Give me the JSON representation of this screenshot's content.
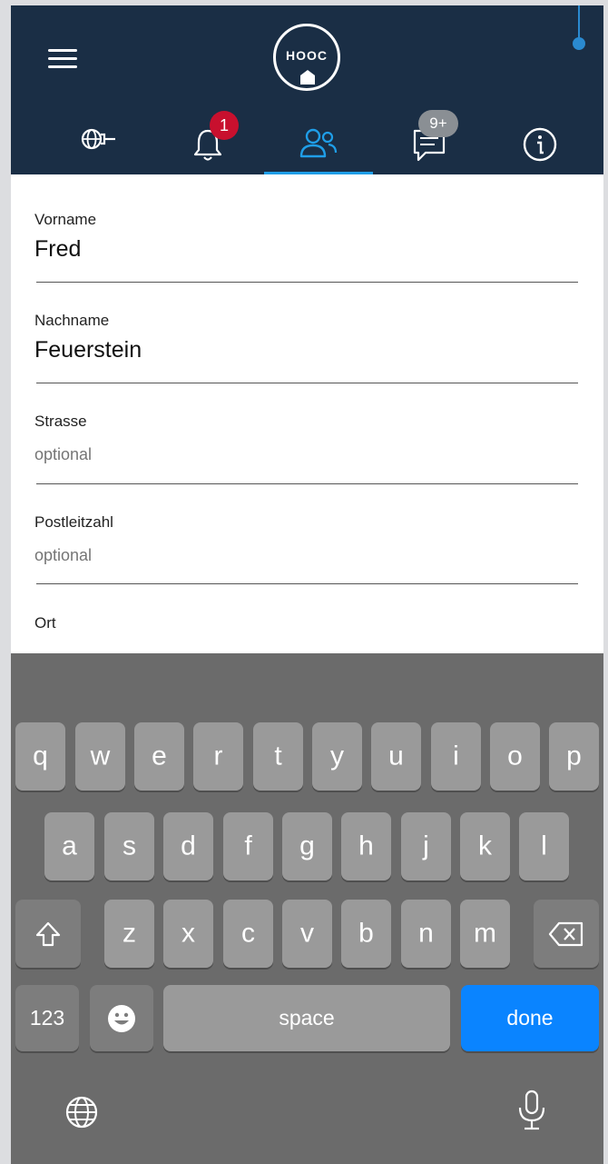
{
  "header": {
    "logo_text": "HOOC",
    "menu_icon": "hamburger-icon",
    "tabs": [
      {
        "icon": "globe-plug-icon"
      },
      {
        "icon": "bell-icon",
        "badge": "1"
      },
      {
        "icon": "users-icon",
        "active": true
      },
      {
        "icon": "chat-icon",
        "badge": "9+"
      },
      {
        "icon": "info-icon"
      }
    ],
    "accent_color": "#1f9ee8",
    "bar_color": "#1a2e45"
  },
  "form": {
    "vorname": {
      "label": "Vorname",
      "value": "Fred"
    },
    "nachname": {
      "label": "Nachname",
      "value": "Feuerstein"
    },
    "strasse": {
      "label": "Strasse",
      "placeholder": "optional"
    },
    "postleitzahl": {
      "label": "Postleitzahl",
      "placeholder": "optional"
    },
    "ort": {
      "label": "Ort"
    }
  },
  "keyboard": {
    "row1": [
      "q",
      "w",
      "e",
      "r",
      "t",
      "y",
      "u",
      "i",
      "o",
      "p"
    ],
    "row2": [
      "a",
      "s",
      "d",
      "f",
      "g",
      "h",
      "j",
      "k",
      "l"
    ],
    "row3": [
      "z",
      "x",
      "c",
      "v",
      "b",
      "n",
      "m"
    ],
    "numbers_label": "123",
    "space_label": "space",
    "done_label": "done",
    "shift_icon": "shift-icon",
    "backspace_icon": "backspace-icon",
    "emoji_icon": "emoji-icon",
    "globe_icon": "globe-icon",
    "mic_icon": "microphone-icon"
  }
}
